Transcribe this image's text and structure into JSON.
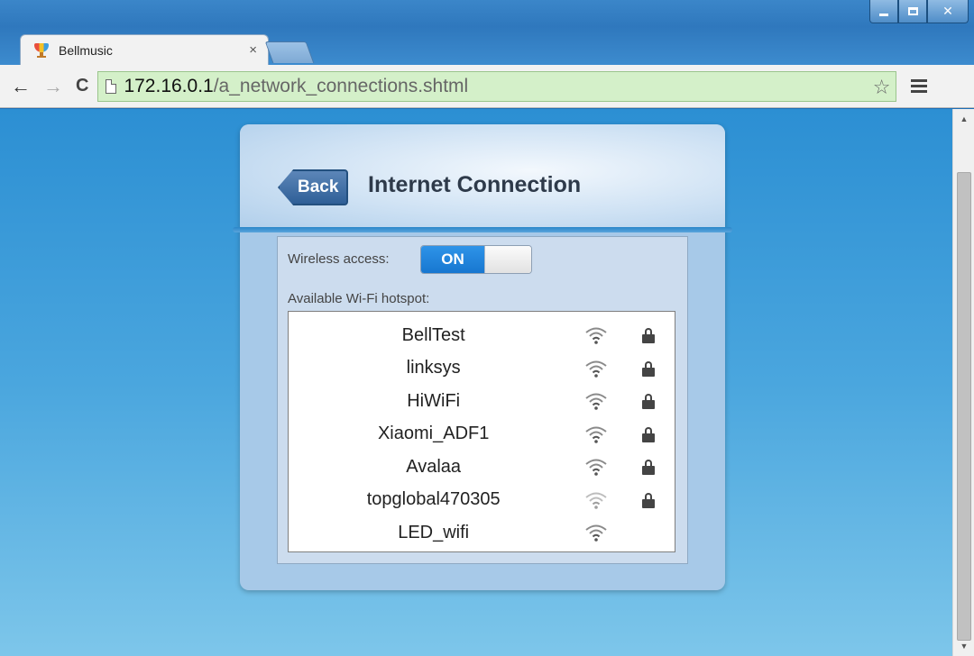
{
  "browser": {
    "tab_title": "Bellmusic",
    "tab_close": "×",
    "url_host": "172.16.0.1",
    "url_path": "/a_network_connections.shtml"
  },
  "panel": {
    "back_label": "Back",
    "title": "Internet Connection",
    "wireless_label": "Wireless access:",
    "toggle_state": "ON",
    "hotspot_label": "Available Wi-Fi hotspot:"
  },
  "hotspots": [
    {
      "ssid": "BellTest",
      "locked": true,
      "signal": "strong"
    },
    {
      "ssid": "linksys",
      "locked": true,
      "signal": "strong"
    },
    {
      "ssid": "HiWiFi",
      "locked": true,
      "signal": "strong"
    },
    {
      "ssid": "Xiaomi_ADF1",
      "locked": true,
      "signal": "strong"
    },
    {
      "ssid": "Avalaa",
      "locked": true,
      "signal": "strong"
    },
    {
      "ssid": "topglobal470305",
      "locked": true,
      "signal": "weak"
    },
    {
      "ssid": "LED_wifi",
      "locked": false,
      "signal": "strong"
    }
  ],
  "colors": {
    "toggle_on": "#1777d0",
    "omnibox_secure": "#d4f0c9"
  },
  "icons": {
    "wifi": "wifi-icon",
    "lock": "lock-icon"
  }
}
